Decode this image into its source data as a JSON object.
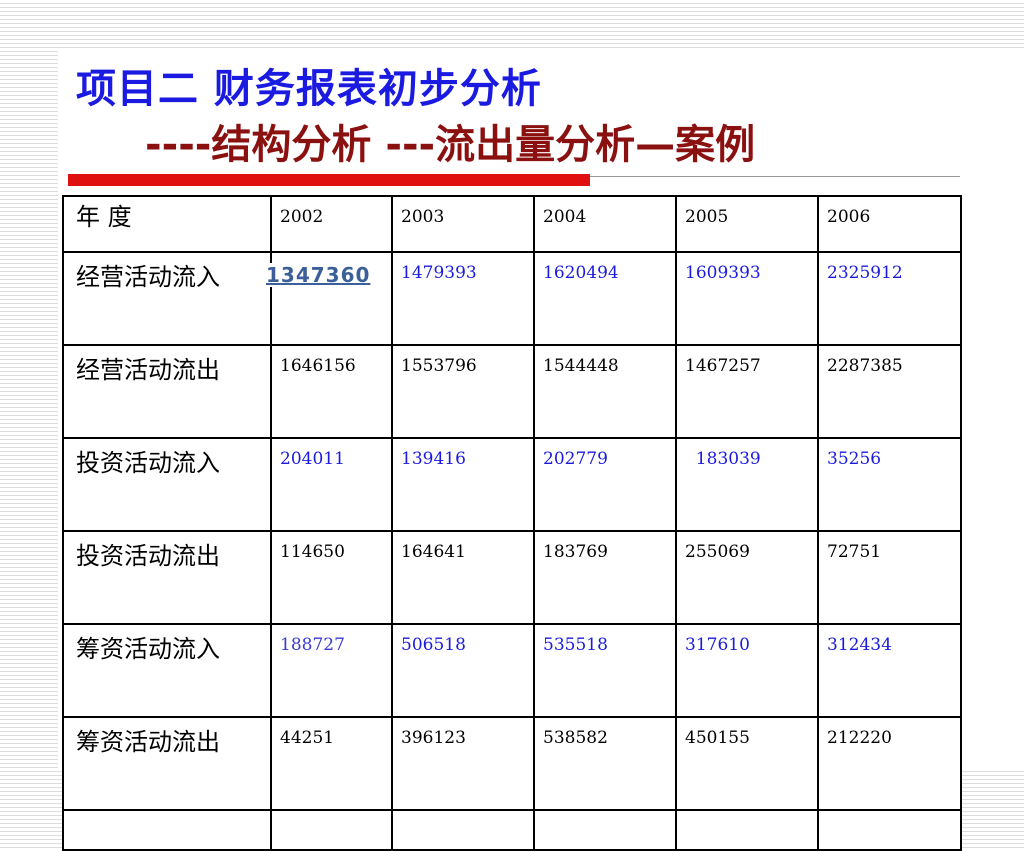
{
  "title": {
    "line1": "项目二  财务报表初步分析",
    "line2_prefix": "----",
    "line2_part1": "结构分析 ",
    "line2_dash": "---",
    "line2_part2": "流出量分析—案例"
  },
  "table": {
    "header": [
      "年  度",
      "2002",
      "2003",
      "2004",
      "2005",
      "2006"
    ],
    "rows": [
      {
        "label": " 经营活动流入",
        "values": [
          "1347360",
          "1479393",
          "1620494",
          "1609393",
          "2325912"
        ]
      },
      {
        "label": " 经营活动流出",
        "values": [
          "1646156",
          "1553796",
          "1544448",
          "1467257",
          "2287385"
        ]
      },
      {
        "label": " 投资活动流入",
        "values": [
          "204011",
          "139416",
          "202779",
          "  183039",
          "35256"
        ]
      },
      {
        "label": "投资活动流出",
        "values": [
          "114650",
          "164641",
          "183769",
          "255069",
          "72751"
        ]
      },
      {
        "label": " 筹资活动流入",
        "values": [
          "188727",
          "506518",
          "535518",
          "317610",
          "312434"
        ]
      },
      {
        "label": "筹资活动流出",
        "values": [
          "44251",
          "396123",
          "538582",
          "450155",
          "212220"
        ]
      }
    ]
  },
  "colors": {
    "title_blue": "#1a1ae0",
    "title_darkred": "#8b1010",
    "accent_red_bar": "#e01010",
    "inflow_blue": "#1a1ae0",
    "highlight_value": "#3b5f98"
  }
}
